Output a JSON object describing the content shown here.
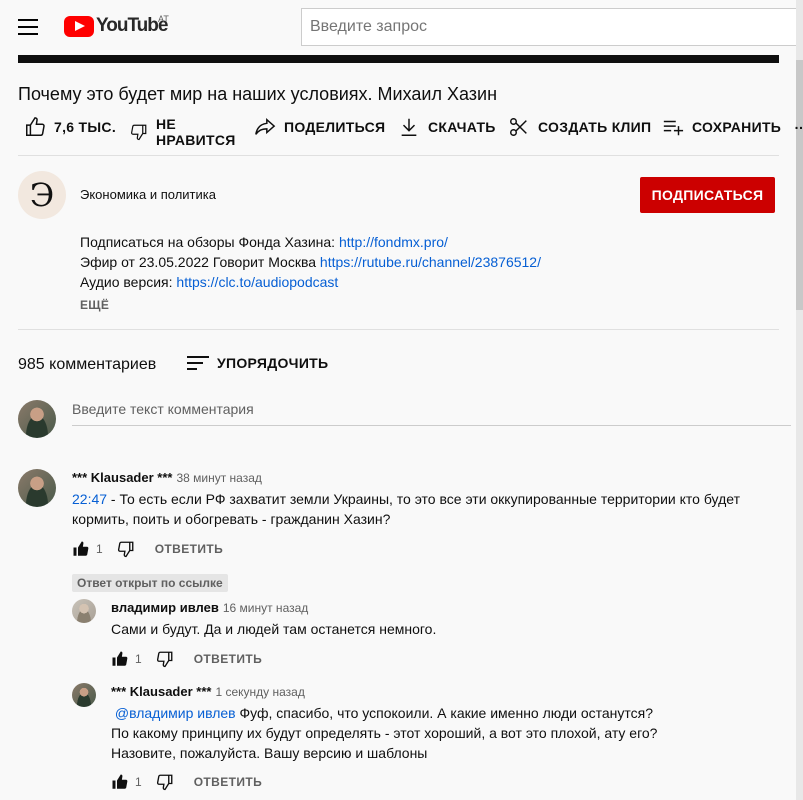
{
  "header": {
    "logo_text": "YouTube",
    "country_code": "AT",
    "search_placeholder": "Введите запрос"
  },
  "video": {
    "title": "Почему это будет мир на наших условиях. Михаил Хазин"
  },
  "actions": {
    "like_count": "7,6 ТЫС.",
    "dislike_label_1": "НЕ",
    "dislike_label_2": "НРАВИТСЯ",
    "share": "ПОДЕЛИТЬСЯ",
    "download": "СКАЧАТЬ",
    "clip": "СОЗДАТЬ КЛИП",
    "save": "СОХРАНИТЬ",
    "more": "…"
  },
  "channel": {
    "avatar_letter": "Э",
    "name": "Экономика и политика",
    "subscribe": "ПОДПИСАТЬСЯ"
  },
  "description": {
    "line1_text": "Подписаться на обзоры Фонда Хазина: ",
    "line1_link": "http://fondmx.pro/",
    "line2_text": "Эфир от 23.05.2022 Говорит Москва ",
    "line2_link": "https://rutube.ru/channel/23876512/",
    "line3_text": "Аудио версия: ",
    "line3_link": "https://clc.to/audiopodcast",
    "more": "ЕЩЁ"
  },
  "comments_header": {
    "count": "985 комментариев",
    "sort": "УПОРЯДОЧИТЬ",
    "input_placeholder": "Введите текст комментария"
  },
  "comment": {
    "author": "*** Klausader ***",
    "time": "38 минут назад",
    "timestamp_link": "22:47",
    "text_line1": " - То есть если РФ захватит земли Украины, то это все эти оккупированные территории кто будет",
    "text_line2": "кормить, поить и обогревать - гражданин Хазин?",
    "likes": "1",
    "reply": "ОТВЕТИТЬ"
  },
  "linked_badge": "Ответ открыт по ссылке",
  "replies": [
    {
      "author": "владимир ивлев",
      "time": "16 минут назад",
      "text": "Сами и будут. Да и людей там останется немного.",
      "likes": "1",
      "reply": "ОТВЕТИТЬ"
    },
    {
      "author": "*** Klausader ***",
      "time": "1 секунду назад",
      "mention": "@владимир ивлев",
      "text_line1": " Фуф, спасибо, что успокоили. А какие именно люди останутся?",
      "text_line2": "По какому принципу их будут определять - этот хороший, а вот это плохой, ату его?",
      "text_line3": "Назовите, пожалуйста. Вашу версию и шаблоны",
      "likes": "1",
      "reply": "ОТВЕТИТЬ"
    }
  ],
  "colors": {
    "accent_red": "#cc0000",
    "link_blue": "#065fd4",
    "secondary_text": "#606060"
  }
}
